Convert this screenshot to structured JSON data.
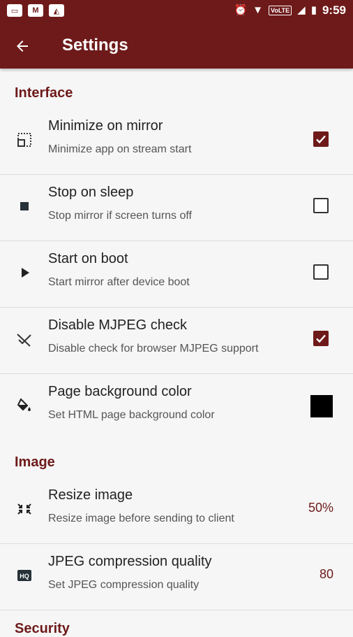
{
  "status_bar": {
    "time": "9:59",
    "network_badge": "VoLTE",
    "notification_icons": [
      "tv-icon",
      "gmail-icon",
      "app-icon"
    ]
  },
  "app_bar": {
    "title": "Settings"
  },
  "sections": [
    {
      "name": "Interface"
    },
    {
      "name": "Image"
    },
    {
      "name": "Security"
    }
  ],
  "prefs": [
    {
      "title": "Minimize on mirror",
      "summary": "Minimize app on stream start",
      "checked": true,
      "icon": "minimize-icon"
    },
    {
      "title": "Stop on sleep",
      "summary": "Stop mirror if screen turns off",
      "checked": false,
      "icon": "stop-icon"
    },
    {
      "title": "Start on boot",
      "summary": "Start mirror after device boot",
      "checked": false,
      "icon": "play-icon"
    },
    {
      "title": "Disable MJPEG check",
      "summary": "Disable check for browser MJPEG support",
      "checked": true,
      "icon": "no-check-icon"
    },
    {
      "title": "Page background color",
      "summary": "Set HTML page background color",
      "color": "#000000",
      "icon": "paint-bucket-icon"
    },
    {
      "title": "Resize image",
      "summary": "Resize image before sending to client",
      "value": "50%",
      "icon": "resize-icon"
    },
    {
      "title": "JPEG compression quality",
      "summary": "Set JPEG compression quality",
      "value": "80",
      "icon": "hq-icon"
    }
  ],
  "colors": {
    "primary": "#6e1a1a",
    "background": "#f6f6f6",
    "divider": "#dcdcdc"
  }
}
